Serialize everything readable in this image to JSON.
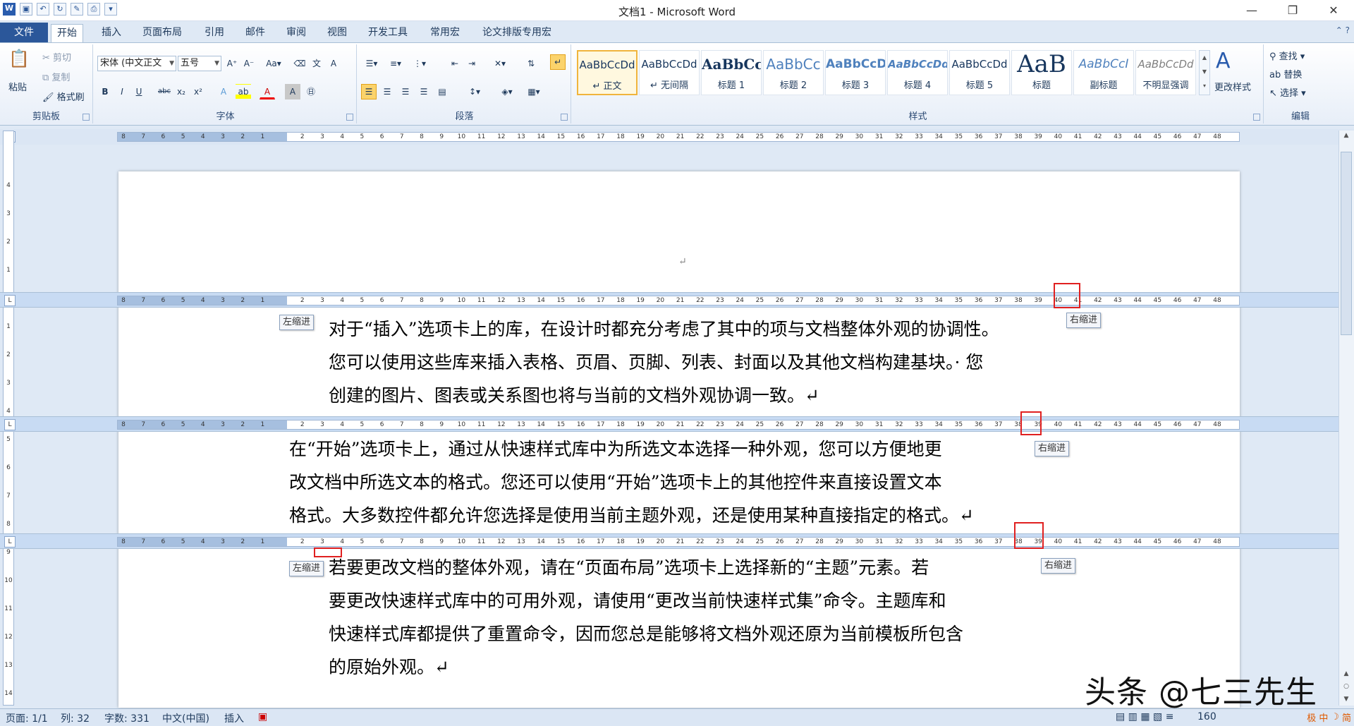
{
  "app": {
    "title": "文档1 - Microsoft Word",
    "window_buttons": [
      "—",
      "❐",
      "✕"
    ]
  },
  "tabs": [
    "文件",
    "开始",
    "插入",
    "页面布局",
    "引用",
    "邮件",
    "审阅",
    "视图",
    "开发工具",
    "常用宏",
    "论文排版专用宏"
  ],
  "clipboard": {
    "paste": "粘贴",
    "cut": "剪切",
    "copy": "复制",
    "format_painter": "格式刷",
    "label": "剪贴板"
  },
  "font": {
    "name": "宋体 (中文正文",
    "size": "五号",
    "label": "字体",
    "bold": "B",
    "italic": "I",
    "underline": "U",
    "strike": "abc",
    "sub": "x₂",
    "sup": "x²",
    "color": "A"
  },
  "paragraph": {
    "label": "段落"
  },
  "styles": {
    "label": "样式",
    "items": [
      {
        "preview": "AaBbCcDd",
        "name": "↵ 正文"
      },
      {
        "preview": "AaBbCcDd",
        "name": "↵ 无间隔"
      },
      {
        "preview": "AaBbCc",
        "name": "标题 1"
      },
      {
        "preview": "AaBbCc",
        "name": "标题 2"
      },
      {
        "preview": "AaBbCcD",
        "name": "标题 3"
      },
      {
        "preview": "AaBbCcDd",
        "name": "标题 4"
      },
      {
        "preview": "AaBbCcDd",
        "name": "标题 5"
      },
      {
        "preview": "AaB",
        "name": "标题"
      },
      {
        "preview": "AaBbCcI",
        "name": "副标题"
      },
      {
        "preview": "AaBbCcDd",
        "name": "不明显强调"
      }
    ],
    "change_styles": "更改样式"
  },
  "editing": {
    "find": "查找",
    "replace": "替换",
    "select": "选择",
    "label": "编辑"
  },
  "ruler": {
    "left_labels": [
      "8",
      "7",
      "6",
      "5",
      "4",
      "3",
      "2",
      "1"
    ],
    "right_labels": [
      "2",
      "3",
      "4",
      "5",
      "6",
      "7",
      "8",
      "9",
      "10",
      "11",
      "12",
      "13",
      "14",
      "15",
      "16",
      "17",
      "18",
      "19",
      "20",
      "21",
      "22",
      "23",
      "24",
      "25",
      "26",
      "27",
      "28",
      "29",
      "30",
      "31",
      "32",
      "33",
      "34",
      "35",
      "36",
      "37",
      "38",
      "39",
      "40",
      "41",
      "42",
      "43",
      "44",
      "45",
      "46",
      "47",
      "48"
    ],
    "tab_stop_symbol": "L"
  },
  "tooltips": {
    "left_indent": "左缩进",
    "right_indent": "右缩进"
  },
  "document": {
    "empty_para_mark": "↵",
    "para1": [
      "对于“插入”选项卡上的库，在设计时都充分考虑了其中的项与文档整体外观的协调性。",
      "您可以使用这些库来插入表格、页眉、页脚、列表、封面以及其他文档构建基块。· 您",
      "创建的图片、图表或关系图也将与当前的文档外观协调一致。↵"
    ],
    "para2": [
      "在“开始”选项卡上，通过从快速样式库中为所选文本选择一种外观，您可以方便地更",
      "改文档中所选文本的格式。您还可以使用“开始”选项卡上的其他控件来直接设置文本",
      "格式。大多数控件都允许您选择是使用当前主题外观，还是使用某种直接指定的格式。↵"
    ],
    "para3": [
      "若要更改文档的整体外观，请在“页面布局”选项卡上选择新的“主题”元素。若",
      "要更改快速样式库中的可用外观，请使用“更改当前快速样式集”命令。主题库和",
      "快速样式库都提供了重置命令，因而您总是能够将文档外观还原为当前模板所包含",
      "的原始外观。↵"
    ]
  },
  "status": {
    "page": "页面: 1/1",
    "col": "列: 32",
    "words": "字数: 331",
    "lang": "中文(中国)",
    "mode": "插入",
    "zoom": "160"
  },
  "watermark": "头条 @七三先生",
  "ime": [
    "极",
    "中",
    "☽",
    "简"
  ]
}
